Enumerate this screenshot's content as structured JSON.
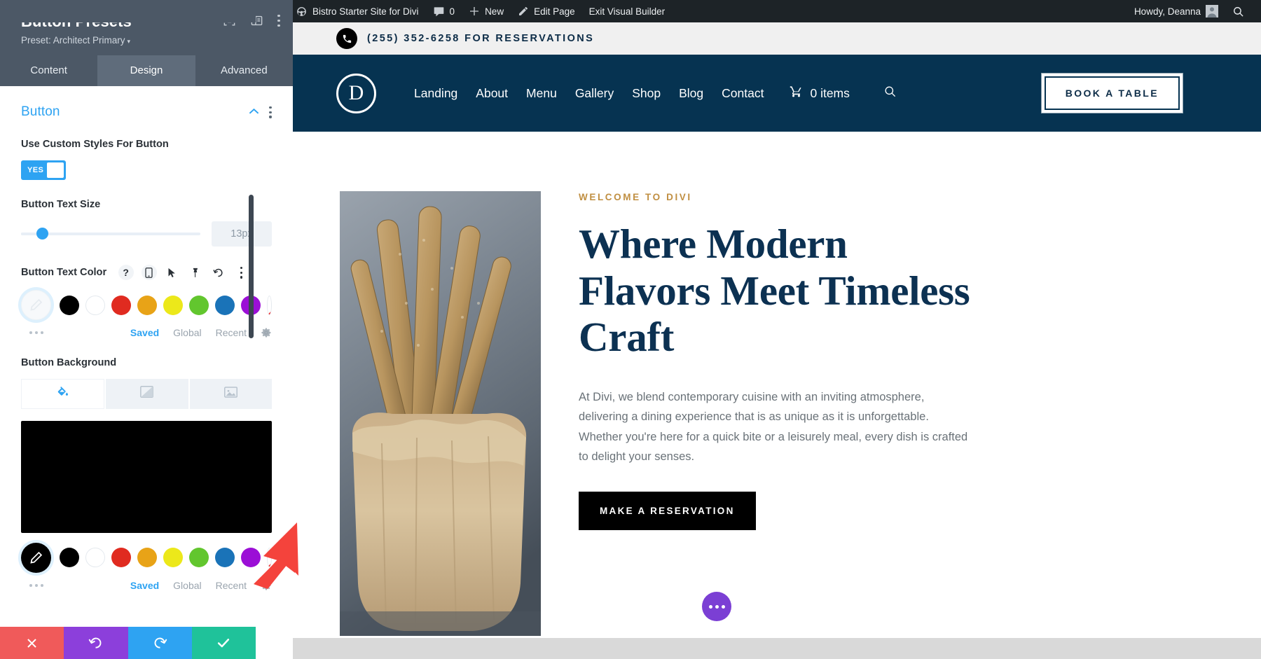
{
  "settings_panel": {
    "title": "Button Presets",
    "preset_label": "Preset: Architect Primary",
    "preset_caret": "▾",
    "header_icons": [
      "target-icon",
      "layout-icon",
      "kebab-menu-icon"
    ],
    "tabs": [
      {
        "label": "Content",
        "active": false
      },
      {
        "label": "Design",
        "active": true
      },
      {
        "label": "Advanced",
        "active": false
      }
    ],
    "section": {
      "title": "Button",
      "collapse_icon": "chevron-up-icon",
      "menu_icon": "kebab-menu-icon"
    },
    "fields": {
      "custom_styles": {
        "label": "Use Custom Styles For Button",
        "toggle_value": "YES",
        "toggle_on": true
      },
      "text_size": {
        "label": "Button Text Size",
        "value": "13px",
        "slider_percent": 9
      },
      "text_color": {
        "label": "Button Text Color",
        "icons": [
          "help-icon",
          "mobile-icon",
          "cursor-icon",
          "pin-icon",
          "reset-icon",
          "kebab-menu-icon"
        ],
        "selected": "none",
        "swatches": [
          "#000000",
          "#ffffff",
          "#e02b20",
          "#e8a317",
          "#ece81a",
          "#62c62e",
          "#1a73b8",
          "#9b0fd6",
          "transparent"
        ],
        "footer_links": [
          "Saved",
          "Global",
          "Recent"
        ],
        "footer_active": "Saved",
        "gear_icon": "gear-icon",
        "more_icon": "more-dots-icon"
      },
      "background": {
        "label": "Button Background",
        "tabs": [
          "fill-color-icon",
          "gradient-icon",
          "image-icon"
        ],
        "active_tab": 0,
        "preview_color": "#000000",
        "selected": "#000000",
        "swatches": [
          "#000000",
          "#ffffff",
          "#e02b20",
          "#e8a317",
          "#ece81a",
          "#62c62e",
          "#1a73b8",
          "#9b0fd6",
          "transparent"
        ],
        "footer_links": [
          "Saved",
          "Global",
          "Recent"
        ],
        "footer_active": "Saved",
        "gear_icon": "gear-icon",
        "more_icon": "more-dots-icon",
        "eyedropper_icon": "eyedropper-icon"
      }
    },
    "action_bar": [
      {
        "name": "discard-button",
        "icon": "close-icon",
        "color": "#f05a5a"
      },
      {
        "name": "undo-button",
        "icon": "undo-icon",
        "color": "#8c3fdb"
      },
      {
        "name": "redo-button",
        "icon": "redo-icon",
        "color": "#2ea3f2"
      },
      {
        "name": "save-button",
        "icon": "check-icon",
        "color": "#1fc29a"
      }
    ]
  },
  "wp_admin_bar": {
    "logo_icon": "wordpress-icon",
    "site_icon": "dashboard-icon",
    "site_name": "Bistro Starter Site for Divi",
    "comments_icon": "comment-icon",
    "comments_count": "0",
    "new_icon": "plus-icon",
    "new_label": "New",
    "edit_icon": "pencil-icon",
    "edit_label": "Edit Page",
    "exit_label": "Exit Visual Builder",
    "howdy": "Howdy, Deanna",
    "avatar_icon": "avatar-icon",
    "search_icon": "search-icon"
  },
  "site": {
    "topbar": {
      "phone_icon": "phone-icon",
      "text": "(255) 352-6258 FOR RESERVATIONS"
    },
    "nav": {
      "logo_letter": "D",
      "links": [
        "Landing",
        "About",
        "Menu",
        "Gallery",
        "Shop",
        "Blog",
        "Contact"
      ],
      "cart_icon": "cart-icon",
      "cart_label": "0 items",
      "search_icon": "search-icon",
      "cta_label": "BOOK A TABLE"
    },
    "hero": {
      "image_alt": "bread-sticks-in-paper-bag-photo",
      "eyebrow": "WELCOME TO DIVI",
      "heading": "Where Modern Flavors Meet Timeless Craft",
      "paragraph": "At Divi, we blend contemporary cuisine with an inviting atmosphere, delivering a dining experience that is as unique as it is unforgettable. Whether you're here for a quick bite or a leisurely meal, every dish is crafted to delight your senses.",
      "cta_label": "MAKE A RESERVATION"
    },
    "floating_button": {
      "icon": "ellipsis-icon",
      "color": "#7b3fd4"
    },
    "side_tab": {
      "icon": "phone-icon",
      "color": "#2ecc8f"
    }
  },
  "annotation": {
    "arrow": "red-arrow-pointing-to-save-button",
    "color": "#f4433c"
  },
  "colors": {
    "panel_header": "#4c5866",
    "accent_blue": "#2ea3f2",
    "site_navy": "#063351",
    "site_gold": "#c08f42",
    "heading_navy": "#0c3152"
  }
}
